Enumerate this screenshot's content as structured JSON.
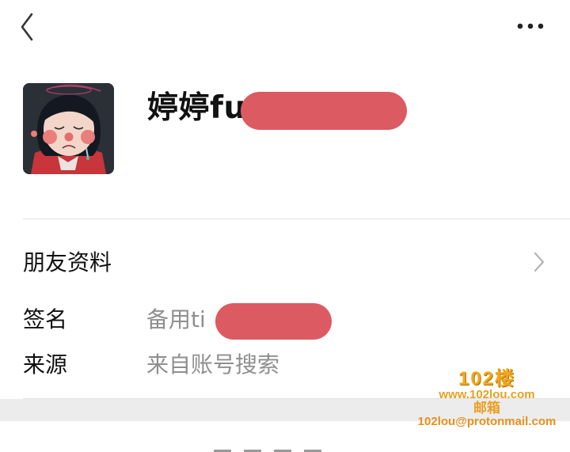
{
  "profile": {
    "name_visible": "婷婷fu"
  },
  "friend_info": {
    "section_title": "朋友资料",
    "rows": [
      {
        "label": "签名",
        "value": "备用ti"
      },
      {
        "label": "来源",
        "value": "来自账号搜索"
      }
    ]
  },
  "watermark": {
    "brand": "102楼",
    "site": "www.102lou.com",
    "mail_label": "邮箱",
    "email": "102lou@protonmail.com"
  },
  "colors": {
    "redaction": "#dc5a61",
    "watermark": "#f2a81d"
  },
  "icons": {
    "back": "chevron-left-icon",
    "more": "more-dots-icon",
    "expand": "chevron-right-icon"
  }
}
